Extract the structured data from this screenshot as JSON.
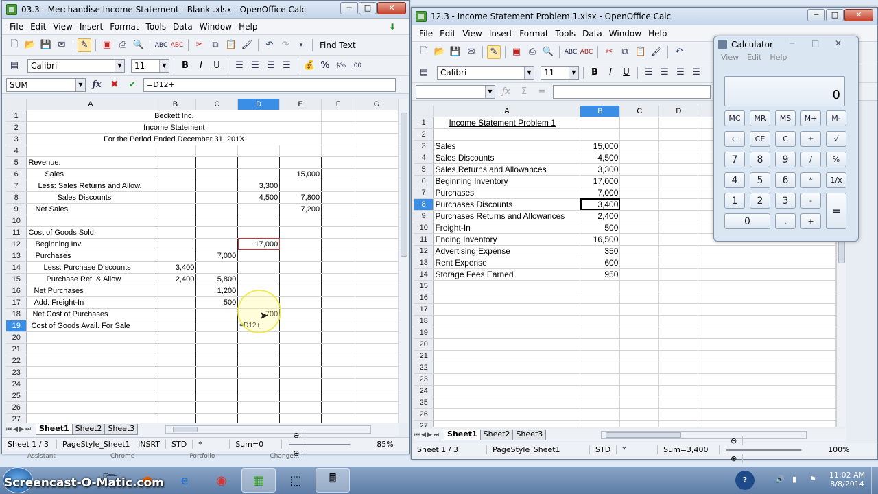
{
  "left_window": {
    "title": "03.3 - Merchandise Income Statement - Blank .xlsx - OpenOffice Calc",
    "menu": [
      "File",
      "Edit",
      "View",
      "Insert",
      "Format",
      "Tools",
      "Data",
      "Window",
      "Help"
    ],
    "find_text": "Find Text",
    "font_name": "Calibri",
    "font_size": "11",
    "name_box": "SUM",
    "formula": "=D12+",
    "columns": [
      "A",
      "B",
      "C",
      "D",
      "E",
      "F",
      "G"
    ],
    "rows": [
      {
        "n": "1",
        "a": "Beckett Inc.",
        "b": "",
        "c": "",
        "d": "",
        "e": ""
      },
      {
        "n": "2",
        "a": "Income Statement",
        "b": "",
        "c": "",
        "d": "",
        "e": ""
      },
      {
        "n": "3",
        "a": "For the Period Ended December 31, 201X",
        "b": "",
        "c": "",
        "d": "",
        "e": ""
      },
      {
        "n": "4",
        "a": "",
        "b": "",
        "c": "",
        "d": "",
        "e": ""
      },
      {
        "n": "5",
        "a": "Revenue:",
        "b": "",
        "c": "",
        "d": "",
        "e": ""
      },
      {
        "n": "6",
        "a": "Sales",
        "b": "",
        "c": "",
        "d": "",
        "e": "15,000"
      },
      {
        "n": "7",
        "a": "Less: Sales Returns and Allow.",
        "b": "",
        "c": "",
        "d": "3,300",
        "e": ""
      },
      {
        "n": "8",
        "a": "Sales Discounts",
        "b": "",
        "c": "",
        "d": "4,500",
        "e": "7,800"
      },
      {
        "n": "9",
        "a": "Net Sales",
        "b": "",
        "c": "",
        "d": "",
        "e": "7,200"
      },
      {
        "n": "10",
        "a": "",
        "b": "",
        "c": "",
        "d": "",
        "e": ""
      },
      {
        "n": "11",
        "a": "Cost of Goods Sold:",
        "b": "",
        "c": "",
        "d": "",
        "e": ""
      },
      {
        "n": "12",
        "a": "Beginning Inv.",
        "b": "",
        "c": "",
        "d": "17,000",
        "e": ""
      },
      {
        "n": "13",
        "a": "Purchases",
        "b": "",
        "c": "7,000",
        "d": "",
        "e": ""
      },
      {
        "n": "14",
        "a": "Less: Purchase Discounts",
        "b": "3,400",
        "c": "",
        "d": "",
        "e": ""
      },
      {
        "n": "15",
        "a": "Purchase Ret. & Allow",
        "b": "2,400",
        "c": "5,800",
        "d": "",
        "e": ""
      },
      {
        "n": "16",
        "a": "Net Purchases",
        "b": "",
        "c": "1,200",
        "d": "",
        "e": ""
      },
      {
        "n": "17",
        "a": "Add: Freight-In",
        "b": "",
        "c": "500",
        "d": "",
        "e": ""
      },
      {
        "n": "18",
        "a": "Net Cost of Purchases",
        "b": "",
        "c": "",
        "d": "700",
        "e": ""
      },
      {
        "n": "19",
        "a": "Cost of Goods Avail. For Sale",
        "b": "",
        "c": "",
        "d": "=D12+",
        "e": ""
      },
      {
        "n": "20",
        "a": "",
        "b": "",
        "c": "",
        "d": "",
        "e": ""
      },
      {
        "n": "21",
        "a": "",
        "b": "",
        "c": "",
        "d": "",
        "e": ""
      },
      {
        "n": "22",
        "a": "",
        "b": "",
        "c": "",
        "d": "",
        "e": ""
      },
      {
        "n": "23",
        "a": "",
        "b": "",
        "c": "",
        "d": "",
        "e": ""
      },
      {
        "n": "24",
        "a": "",
        "b": "",
        "c": "",
        "d": "",
        "e": ""
      },
      {
        "n": "25",
        "a": "",
        "b": "",
        "c": "",
        "d": "",
        "e": ""
      },
      {
        "n": "26",
        "a": "",
        "b": "",
        "c": "",
        "d": "",
        "e": ""
      },
      {
        "n": "27",
        "a": "",
        "b": "",
        "c": "",
        "d": "",
        "e": ""
      }
    ],
    "tabs": [
      "Sheet1",
      "Sheet2",
      "Sheet3"
    ],
    "status": {
      "sheet": "Sheet 1 / 3",
      "style": "PageStyle_Sheet1",
      "mode": "INSRT",
      "sel": "STD",
      "mod": "*",
      "sum": "Sum=0",
      "zoom": "85%"
    }
  },
  "right_window": {
    "title": "12.3 - Income Statement Problem 1.xlsx - OpenOffice Calc",
    "menu": [
      "File",
      "Edit",
      "View",
      "Insert",
      "Format",
      "Tools",
      "Data",
      "Window",
      "Help"
    ],
    "font_name": "Calibri",
    "font_size": "11",
    "columns": [
      "A",
      "B",
      "C",
      "D"
    ],
    "rows": [
      {
        "n": "1",
        "a": "Income Statement Problem 1",
        "b": ""
      },
      {
        "n": "2",
        "a": "",
        "b": ""
      },
      {
        "n": "3",
        "a": "Sales",
        "b": "15,000"
      },
      {
        "n": "4",
        "a": "Sales Discounts",
        "b": "4,500"
      },
      {
        "n": "5",
        "a": "Sales Returns and Allowances",
        "b": "3,300"
      },
      {
        "n": "6",
        "a": "Beginning Inventory",
        "b": "17,000"
      },
      {
        "n": "7",
        "a": "Purchases",
        "b": "7,000"
      },
      {
        "n": "8",
        "a": "Purchases Discounts",
        "b": "3,400"
      },
      {
        "n": "9",
        "a": "Purchases Returns and Allowances",
        "b": "2,400"
      },
      {
        "n": "10",
        "a": "Freight-In",
        "b": "500"
      },
      {
        "n": "11",
        "a": "Ending Inventory",
        "b": "16,500"
      },
      {
        "n": "12",
        "a": "Advertising Expense",
        "b": "350"
      },
      {
        "n": "13",
        "a": "Rent Expense",
        "b": "600"
      },
      {
        "n": "14",
        "a": "Storage Fees Earned",
        "b": "950"
      },
      {
        "n": "15",
        "a": "",
        "b": ""
      },
      {
        "n": "16",
        "a": "",
        "b": ""
      },
      {
        "n": "17",
        "a": "",
        "b": ""
      },
      {
        "n": "18",
        "a": "",
        "b": ""
      },
      {
        "n": "19",
        "a": "",
        "b": ""
      },
      {
        "n": "20",
        "a": "",
        "b": ""
      },
      {
        "n": "21",
        "a": "",
        "b": ""
      },
      {
        "n": "22",
        "a": "",
        "b": ""
      },
      {
        "n": "23",
        "a": "",
        "b": ""
      },
      {
        "n": "24",
        "a": "",
        "b": ""
      },
      {
        "n": "25",
        "a": "",
        "b": ""
      },
      {
        "n": "26",
        "a": "",
        "b": ""
      },
      {
        "n": "27",
        "a": "",
        "b": ""
      }
    ],
    "tabs": [
      "Sheet1",
      "Sheet2",
      "Sheet3"
    ],
    "status": {
      "sheet": "Sheet 1 / 3",
      "style": "PageStyle_Sheet1",
      "sel": "STD",
      "mod": "*",
      "sum": "Sum=3,400",
      "zoom": "100%"
    }
  },
  "calculator": {
    "title": "Calculator",
    "menu": [
      "View",
      "Edit",
      "Help"
    ],
    "display": "0",
    "buttons": [
      "MC",
      "MR",
      "MS",
      "M+",
      "M-",
      "←",
      "CE",
      "C",
      "±",
      "√",
      "7",
      "8",
      "9",
      "/",
      "%",
      "4",
      "5",
      "6",
      "*",
      "1/x",
      "1",
      "2",
      "3",
      "-",
      "=",
      "0",
      ".",
      "+"
    ]
  },
  "taskbar": {
    "watermark": "Screencast-O-Matic.com",
    "time": "11:02 AM",
    "date": "8/8/2014",
    "behind_labels": [
      "Assistant",
      "Chrome",
      "Portfolio",
      "Change..."
    ]
  }
}
